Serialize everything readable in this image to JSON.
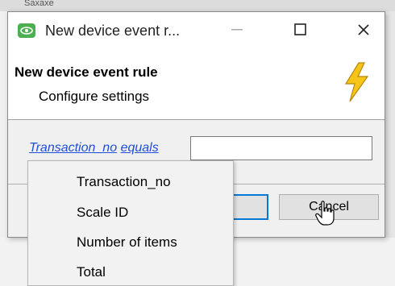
{
  "background": {
    "text": "Saxaxe"
  },
  "window": {
    "title": "New device event r...",
    "controls": {
      "minimize": "—",
      "maximize": "☐",
      "close": "✕"
    }
  },
  "header": {
    "title": "New device event rule",
    "subtitle": "Configure settings"
  },
  "rule": {
    "field_link": "Transaction_no",
    "operator_link": "equals",
    "value": ""
  },
  "buttons": {
    "ok_label": "",
    "cancel_label": "Cancel"
  },
  "dropdown": {
    "items": [
      "Transaction_no",
      "Scale ID",
      "Number of items",
      "Total"
    ]
  },
  "colors": {
    "link": "#1e4fd8",
    "focus_border": "#0078d7",
    "bolt": "#f5c518",
    "app_icon": "#4caf50"
  }
}
